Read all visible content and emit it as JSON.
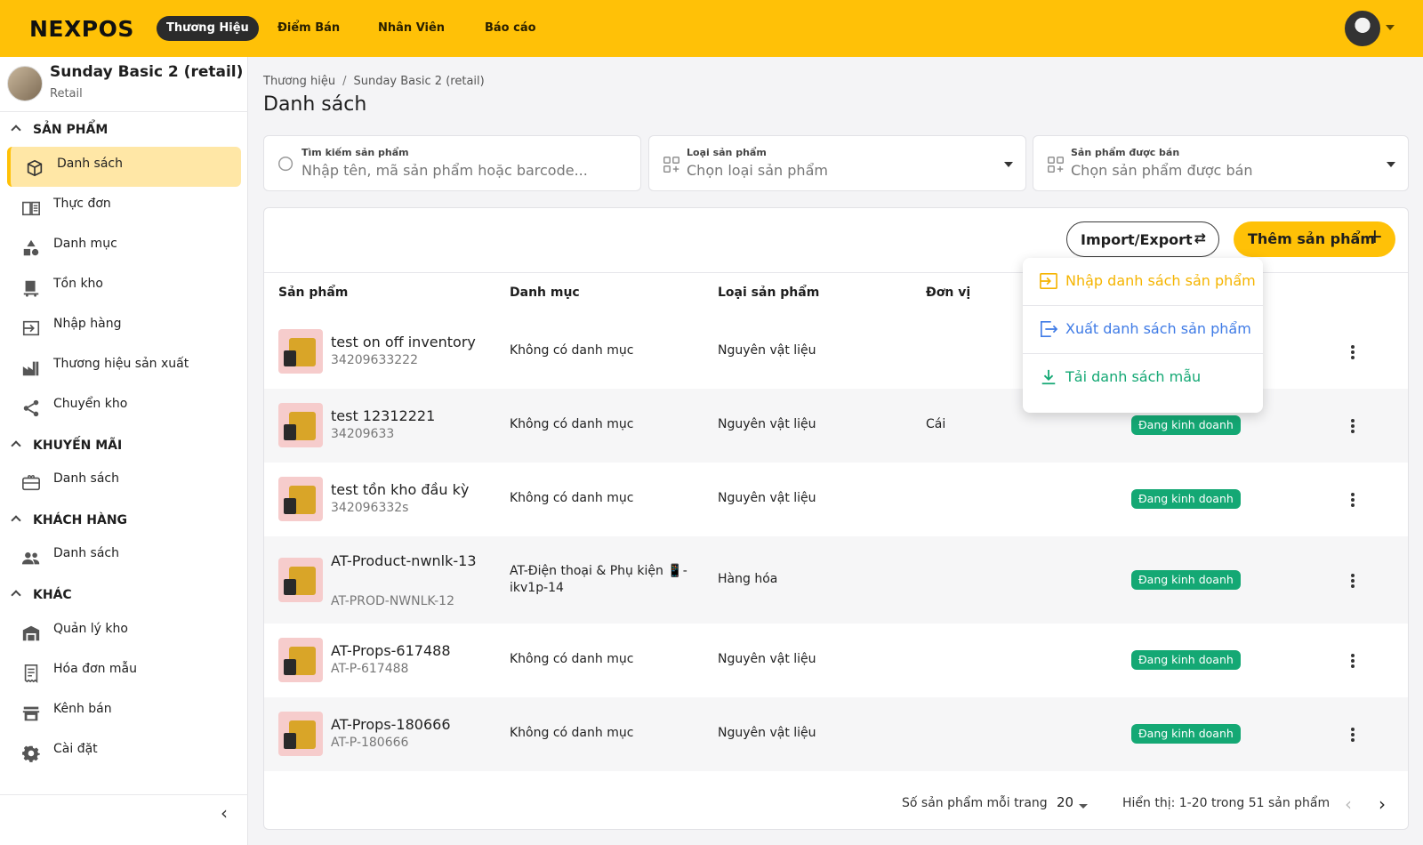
{
  "topbar": {
    "logo": "NEXPOS",
    "nav": [
      "Thương Hiệu",
      "Điểm Bán",
      "Nhân Viên",
      "Báo cáo"
    ],
    "active_nav": "Thương Hiệu",
    "avatar_icon": "user-avatar-icon",
    "colors": {
      "brand": "#ffc107",
      "active_pill": "#2b2b2b"
    }
  },
  "sidebar": {
    "brand_name": "Sunday Basic 2 (retail)",
    "brand_type": "Retail",
    "sections": [
      {
        "title": "SẢN PHẨM",
        "items": [
          {
            "label": "Danh sách",
            "icon": "cube-icon",
            "active": true
          },
          {
            "label": "Thực đơn",
            "icon": "menu-book-icon"
          },
          {
            "label": "Danh mục",
            "icon": "category-shapes-icon"
          },
          {
            "label": "Tồn kho",
            "icon": "inventory-icon"
          },
          {
            "label": "Nhập hàng",
            "icon": "import-icon"
          },
          {
            "label": "Thương hiệu sản xuất",
            "icon": "factory-icon"
          },
          {
            "label": "Chuyển kho",
            "icon": "share-icon"
          }
        ]
      },
      {
        "title": "KHUYẾN MÃI",
        "items": [
          {
            "label": "Danh sách",
            "icon": "gift-card-icon"
          }
        ]
      },
      {
        "title": "KHÁCH HÀNG",
        "items": [
          {
            "label": "Danh sách",
            "icon": "people-icon"
          }
        ]
      },
      {
        "title": "KHÁC",
        "items": [
          {
            "label": "Quản lý kho",
            "icon": "warehouse-icon"
          },
          {
            "label": "Hóa đơn mẫu",
            "icon": "receipt-icon"
          },
          {
            "label": "Kênh bán",
            "icon": "store-icon"
          },
          {
            "label": "Cài đặt",
            "icon": "gear-icon"
          }
        ]
      }
    ]
  },
  "main": {
    "breadcrumb": [
      "Thương hiệu",
      "Sunday Basic 2 (retail)"
    ],
    "breadcrumb_sep": "/",
    "title": "Danh sách",
    "filters": {
      "search": {
        "label": "Tìm kiếm sản phẩm",
        "placeholder": "Nhập tên, mã sản phẩm hoặc barcode..."
      },
      "type": {
        "label": "Loại sản phẩm",
        "value": "Chọn loại sản phẩm"
      },
      "sold": {
        "label": "Sản phẩm được bán",
        "value": "Chọn sản phẩm được bán"
      }
    },
    "actions": {
      "import_export": "Import/Export",
      "add": "Thêm sản phẩm"
    },
    "columns": [
      "Sản phẩm",
      "Danh mục",
      "Loại sản phẩm",
      "Đơn vị"
    ],
    "rows": [
      {
        "name": "test on off inventory",
        "code": "34209633222",
        "category": "Không có danh mục",
        "type": "Nguyên vật liệu",
        "unit": "",
        "status": ""
      },
      {
        "name": "test 12312221",
        "code": "34209633",
        "category": "Không có danh mục",
        "type": "Nguyên vật liệu",
        "unit": "Cái",
        "status": "Đang kinh doanh"
      },
      {
        "name": "test tồn kho đầu kỳ",
        "code": "342096332s",
        "category": "Không có danh mục",
        "type": "Nguyên vật liệu",
        "unit": "",
        "status": "Đang kinh doanh"
      },
      {
        "name": "AT-Product-nwnlk-13",
        "code": "AT-PROD-NWNLK-12",
        "category": "AT-Điện thoại & Phụ kiện 📱-ikv1p-14",
        "type": "Hàng hóa",
        "unit": "",
        "status": "Đang kinh doanh"
      },
      {
        "name": "AT-Props-617488",
        "code": "AT-P-617488",
        "category": "Không có danh mục",
        "type": "Nguyên vật liệu",
        "unit": "",
        "status": "Đang kinh doanh"
      },
      {
        "name": "AT-Props-180666",
        "code": "AT-P-180666",
        "category": "Không có danh mục",
        "type": "Nguyên vật liệu",
        "unit": "",
        "status": "Đang kinh doanh"
      }
    ],
    "status_color": "#14a874",
    "pagination": {
      "per_page_label": "Số sản phẩm mỗi trang",
      "per_page": "20",
      "summary": "Hiển thị: 1-20 trong 51 sản phẩm"
    }
  },
  "dropdown": {
    "items": [
      {
        "label": "Nhập danh sách sản phẩm",
        "icon": "import-list-icon",
        "color": "#f5b400"
      },
      {
        "label": "Xuất danh sách sản phẩm",
        "icon": "export-list-icon",
        "color": "#3f7be6"
      },
      {
        "label": "Tải danh sách mẫu",
        "icon": "download-icon",
        "color": "#14a874"
      }
    ]
  }
}
